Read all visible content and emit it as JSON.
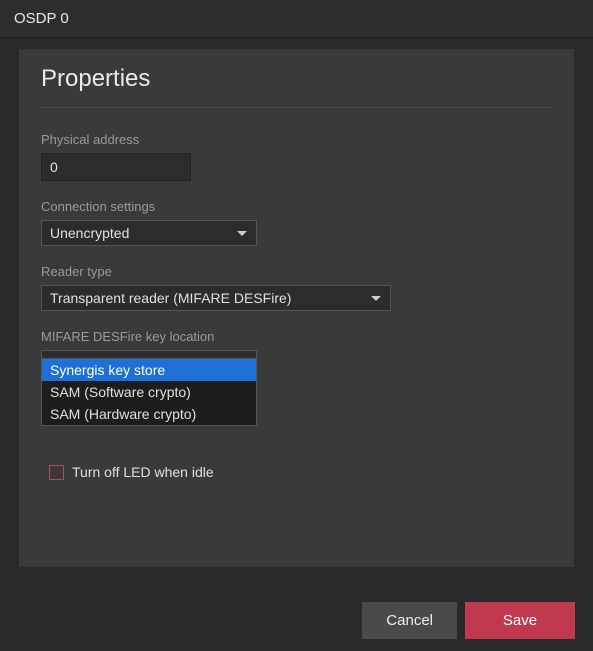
{
  "window": {
    "title": "OSDP 0"
  },
  "panel": {
    "title": "Properties"
  },
  "fields": {
    "physical_address": {
      "label": "Physical address",
      "value": "0"
    },
    "connection": {
      "label": "Connection settings",
      "value": "Unencrypted"
    },
    "reader_type": {
      "label": "Reader type",
      "value": "Transparent reader (MIFARE DESFire)"
    },
    "key_location": {
      "label": "MIFARE DESFire key location",
      "value": "Synergis key store",
      "options": [
        "Synergis key store",
        "SAM (Software crypto)",
        "SAM (Hardware crypto)"
      ],
      "highlighted_index": 0
    }
  },
  "checkbox": {
    "label": "Turn off LED when idle",
    "checked": false
  },
  "footer": {
    "cancel": "Cancel",
    "save": "Save"
  }
}
